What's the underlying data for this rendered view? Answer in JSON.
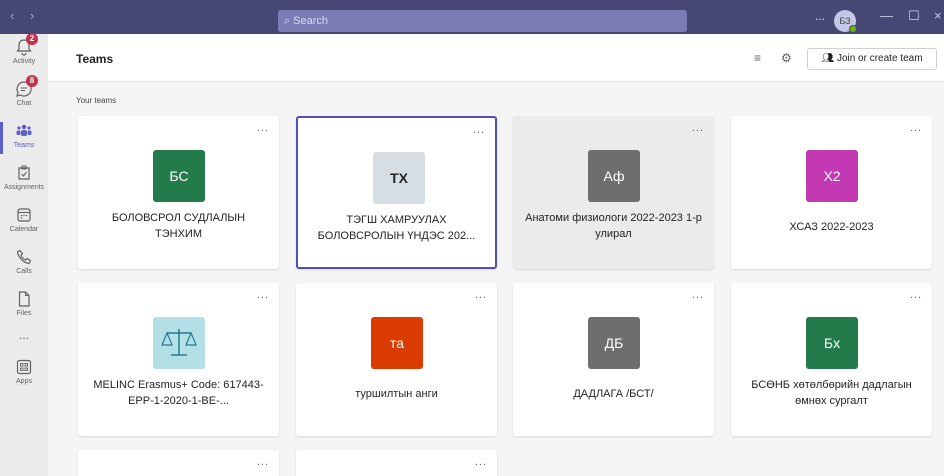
{
  "titlebar": {
    "back_icon": "chevron-left-icon",
    "forward_icon": "chevron-right-icon",
    "search_placeholder": "Search",
    "more": "...",
    "avatar_initials": "БЗ",
    "min": "—",
    "max": "☐",
    "close": "×"
  },
  "rail": {
    "items": [
      {
        "label": "Activity",
        "badge": "2"
      },
      {
        "label": "Chat",
        "badge": "8"
      },
      {
        "label": "Teams"
      },
      {
        "label": "Assignments"
      },
      {
        "label": "Calendar"
      },
      {
        "label": "Calls"
      },
      {
        "label": "Files"
      },
      {
        "label": "..."
      },
      {
        "label": "Apps"
      }
    ]
  },
  "header": {
    "title": "Teams",
    "join_label": "Join or create team"
  },
  "section_label": "Your teams",
  "teams": [
    {
      "initials": "БС",
      "name": "БОЛОВСРОЛ СУДЛАЛЫН ТЭНХИМ",
      "color": "#237b4b"
    },
    {
      "initials": "ТХ",
      "name": "ТЭГШ ХАМРУУЛАХ БОЛОВСРОЛЫН ҮНДЭС 202...",
      "color": "#d6dde3"
    },
    {
      "initials": "Аф",
      "name": "Анатоми физиологи 2022-2023 1-р улирал",
      "color": "#6e6e6e"
    },
    {
      "initials": "Х2",
      "name": "ХСАЗ 2022-2023",
      "color": "#c239b3"
    },
    {
      "initials": "",
      "name": "MELINC Erasmus+ Code: 617443-EPP-1-2020-1-BE-...",
      "color": "#b3e0e6"
    },
    {
      "initials": "та",
      "name": "туршилтын анги",
      "color": "#da3b01"
    },
    {
      "initials": "ДБ",
      "name": "ДАДЛАГА /БСТ/",
      "color": "#6e6e6e"
    },
    {
      "initials": "Бх",
      "name": "БСӨНБ хөтөлбөрийн дадлагын өмнөх сургалт",
      "color": "#237b4b"
    }
  ],
  "card_more": "..."
}
